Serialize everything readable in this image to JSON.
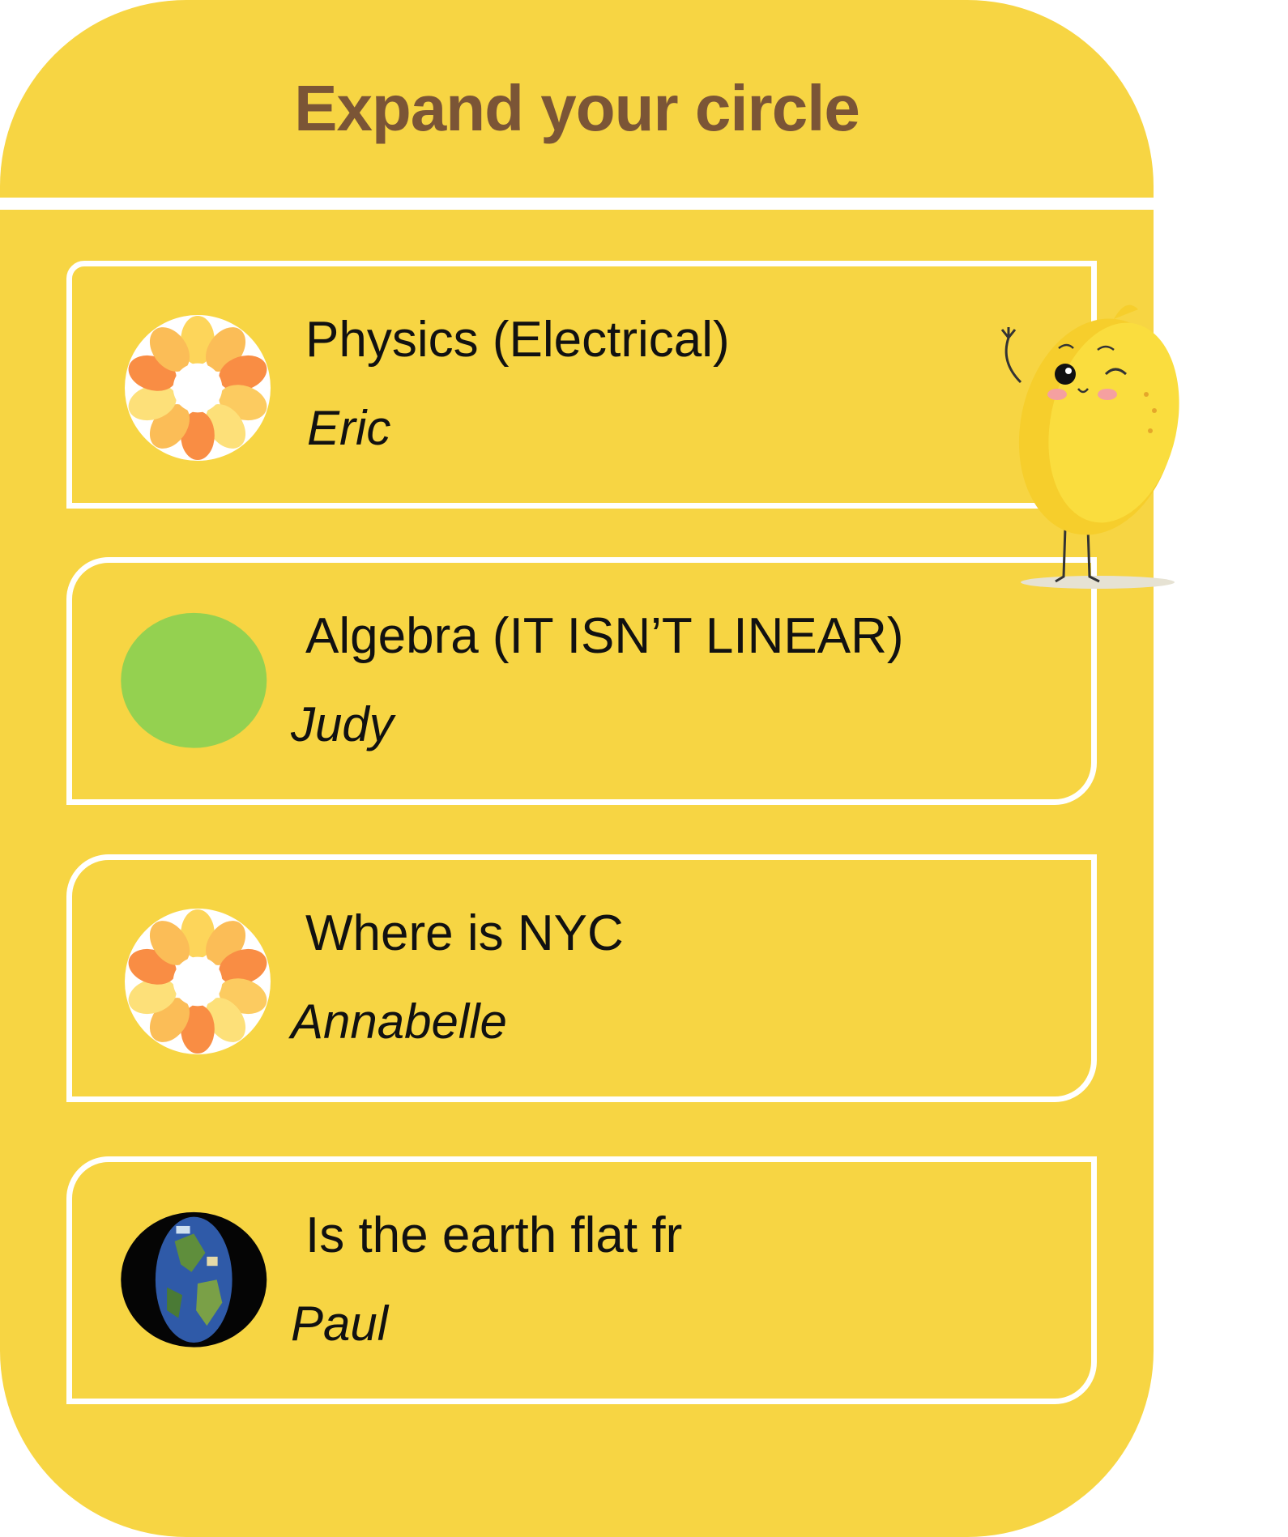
{
  "header": {
    "title": "Expand your circle"
  },
  "cards": [
    {
      "title": "Physics (Electrical)",
      "author": "Eric",
      "avatar": "orange-flower-icon"
    },
    {
      "title": "Algebra (IT ISN’T LINEAR)",
      "author": "Judy",
      "avatar": "green-circle-avatar"
    },
    {
      "title": "Where is NYC",
      "author": "Annabelle",
      "avatar": "orange-flower-icon"
    },
    {
      "title": "Is the earth flat fr",
      "author": "Paul",
      "avatar": "earth-globe-icon"
    }
  ],
  "colors": {
    "panel": "#f7d543",
    "title": "#7b5536",
    "border": "#ffffff",
    "green": "#94d150"
  },
  "mascot": "lemon-mascot-icon"
}
